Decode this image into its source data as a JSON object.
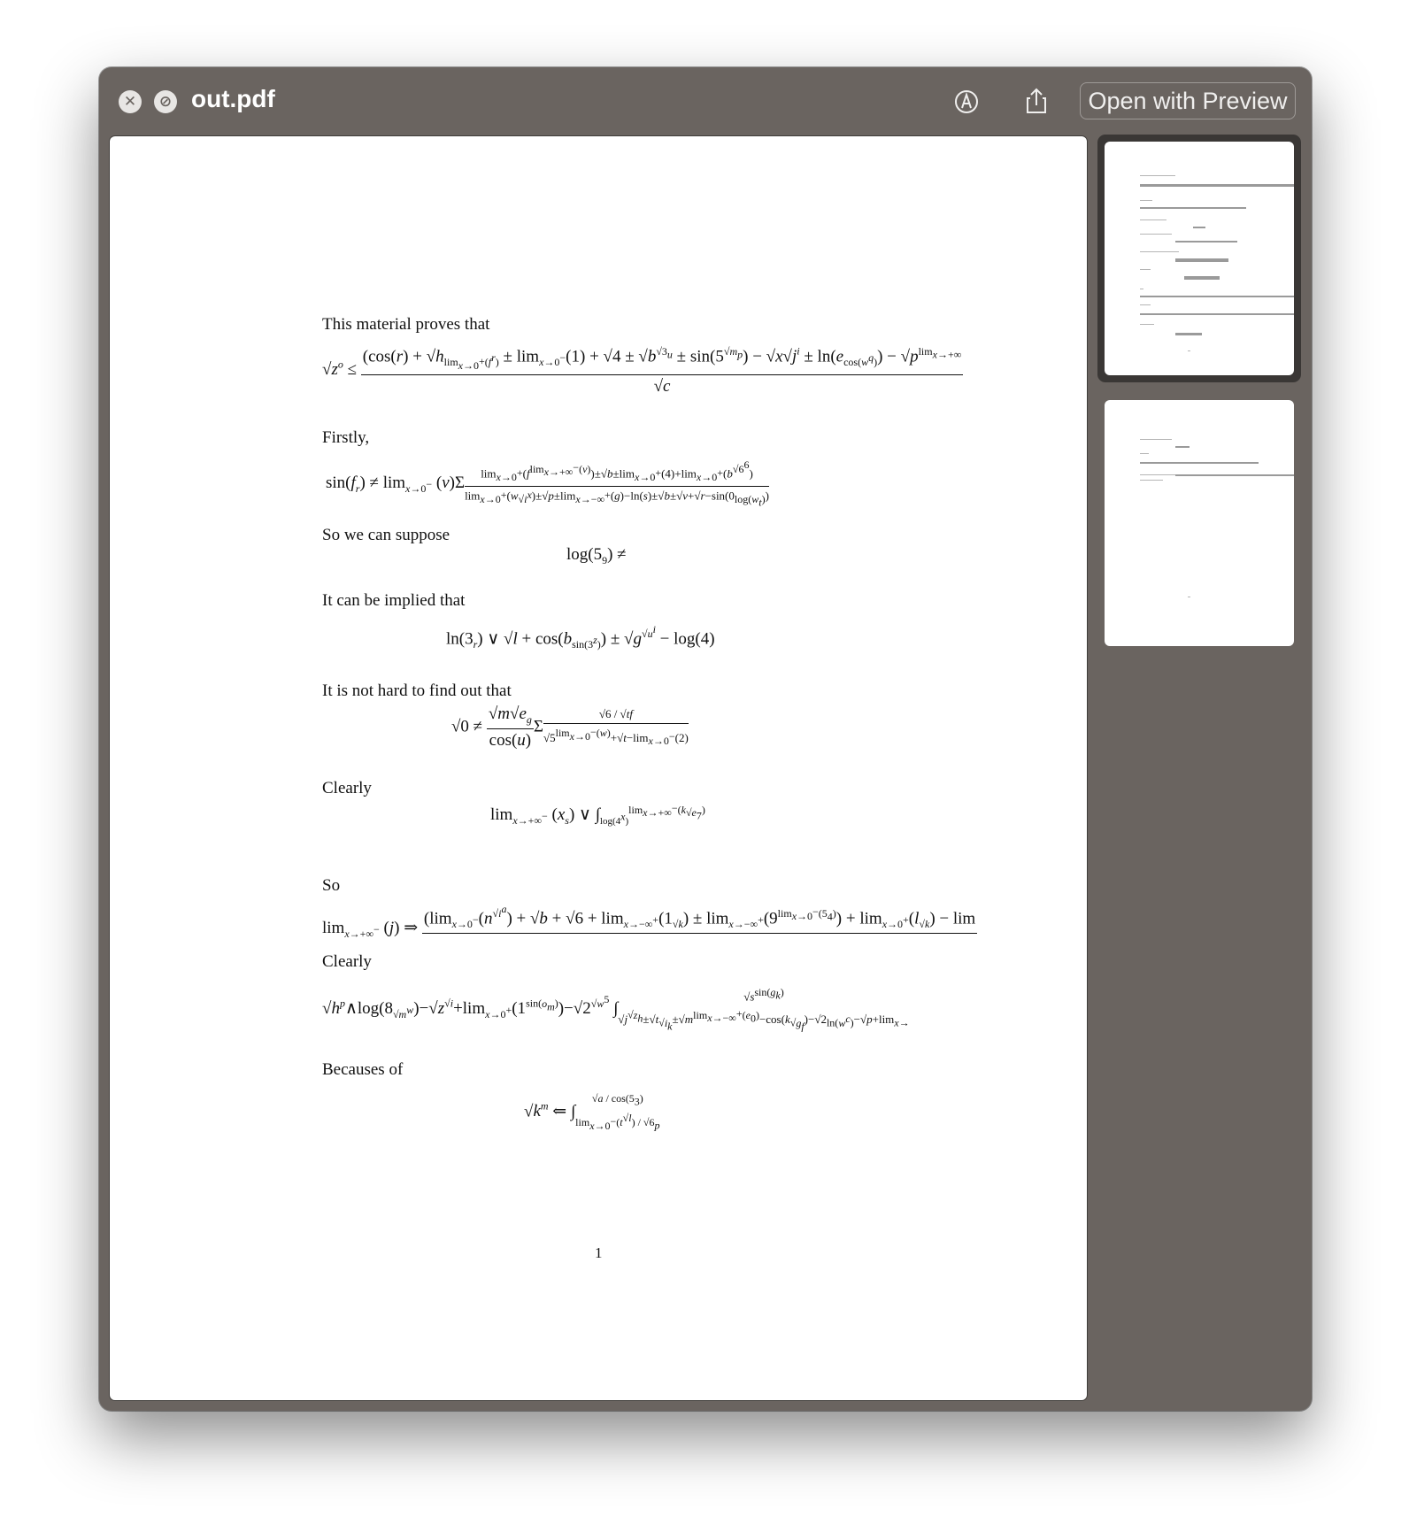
{
  "window": {
    "title": "out.pdf",
    "open_with_label": "Open with Preview",
    "close_glyph": "✕",
    "fullscreen_glyph": "⊘"
  },
  "icons": {
    "close": "close-icon",
    "fullscreen": "fullscreen-icon",
    "markup": "markup-icon",
    "share": "share-icon"
  },
  "document": {
    "paragraphs": [
      "This material proves that",
      "Firstly,",
      "So we can suppose",
      "It can be implied that",
      "It is not hard to find out that",
      "Clearly",
      "So",
      "Clearly",
      "Becauses of"
    ],
    "page_number": "1"
  },
  "colors": {
    "window_bg": "#6a6460",
    "page_bg": "#ffffff",
    "selected_thumb_border": "#3a3735"
  }
}
